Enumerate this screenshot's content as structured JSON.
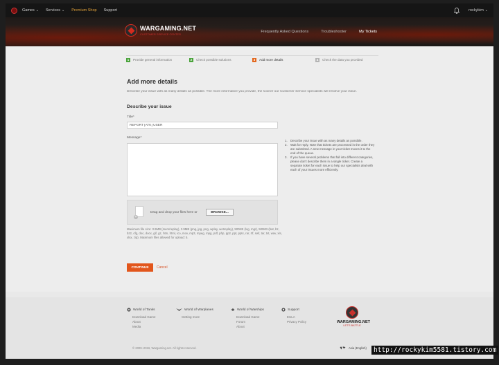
{
  "topnav": {
    "items": [
      {
        "label": "Games",
        "chevron": true
      },
      {
        "label": "Services",
        "chevron": true
      },
      {
        "label": "Premium Shop",
        "chevron": false,
        "color": "#e2a23a"
      },
      {
        "label": "Support",
        "chevron": false
      }
    ],
    "username": "rockykim"
  },
  "header": {
    "brand": "WARGAMING.NET",
    "tagline": "CUSTOMER SERVICE CENTER",
    "nav": [
      "Frequently Asked Questions",
      "Troubleshooter",
      "My Tickets"
    ],
    "active_nav": "My Tickets"
  },
  "steps": [
    {
      "num": "1",
      "label": "Provide general information",
      "state": "done"
    },
    {
      "num": "2",
      "label": "Check possible solutions",
      "state": "done"
    },
    {
      "num": "3",
      "label": "Add more details",
      "state": "current"
    },
    {
      "num": "4",
      "label": "Check the data you provided",
      "state": "future"
    }
  ],
  "form": {
    "page_title": "Add more details",
    "intro": "Describe your issue with as many details as possible. The more informative you provide, the sooner our Customer Service specialists will resolve your issue.",
    "section_title": "Describe your issue",
    "title_label": "Title*",
    "title_value": "REPORT [ATK] USER",
    "message_label": "Message*",
    "tips": [
      "Describe your issue with as many details as possible.",
      "Wait for reply. Note that tickets are processed in the order they are submitted. A new message in your ticket moves it to the end of the queue.",
      "If you have several problems that fall into different categories, please don't describe them in a single ticket. Create a separate ticket for each issue to help our specialists deal with each of your issues more efficiently."
    ],
    "drop_text": "Drag and drop your files here or",
    "browse_label": "BROWSE...",
    "limits": "Maximum file size: 3.9MB (mem/replay), 2.9MB (png, jpg, png, wplay, wotreplay), 500KB (log, mgr), 500KB (bat, bz, bz2, cfg, doc, docx, gif, gz, htm, html, ico, mov, mp3, mpeg, mpg, pdf, php, pp2, ppt, pptx, rar, rtf, swf, tar, txt, wav, xls, xlsx, zip). Maximum files allowed for upload: 5.",
    "continue_label": "CONTINUE",
    "cancel_label": "Cancel",
    "accent": "#e2561c"
  },
  "footer": {
    "columns": [
      {
        "title": "World of Tanks",
        "links": [
          "Download Game",
          "About",
          "Media"
        ]
      },
      {
        "title": "World of Warplanes",
        "links": [
          "Getting more"
        ]
      },
      {
        "title": "World of Warships",
        "links": [
          "Download Game",
          "Forum",
          "About"
        ]
      },
      {
        "title": "Support",
        "links": [
          "EULA",
          "Privacy Policy"
        ]
      }
    ],
    "logo_text": "WARGAMING.NET",
    "logo_tag": "LET'S BATTLE",
    "copyright": "© 2009–2016, Wargaming.net. All rights reserved.",
    "region": "Asia (English)"
  },
  "watermark": "http://rockykim5581.tistory.com"
}
